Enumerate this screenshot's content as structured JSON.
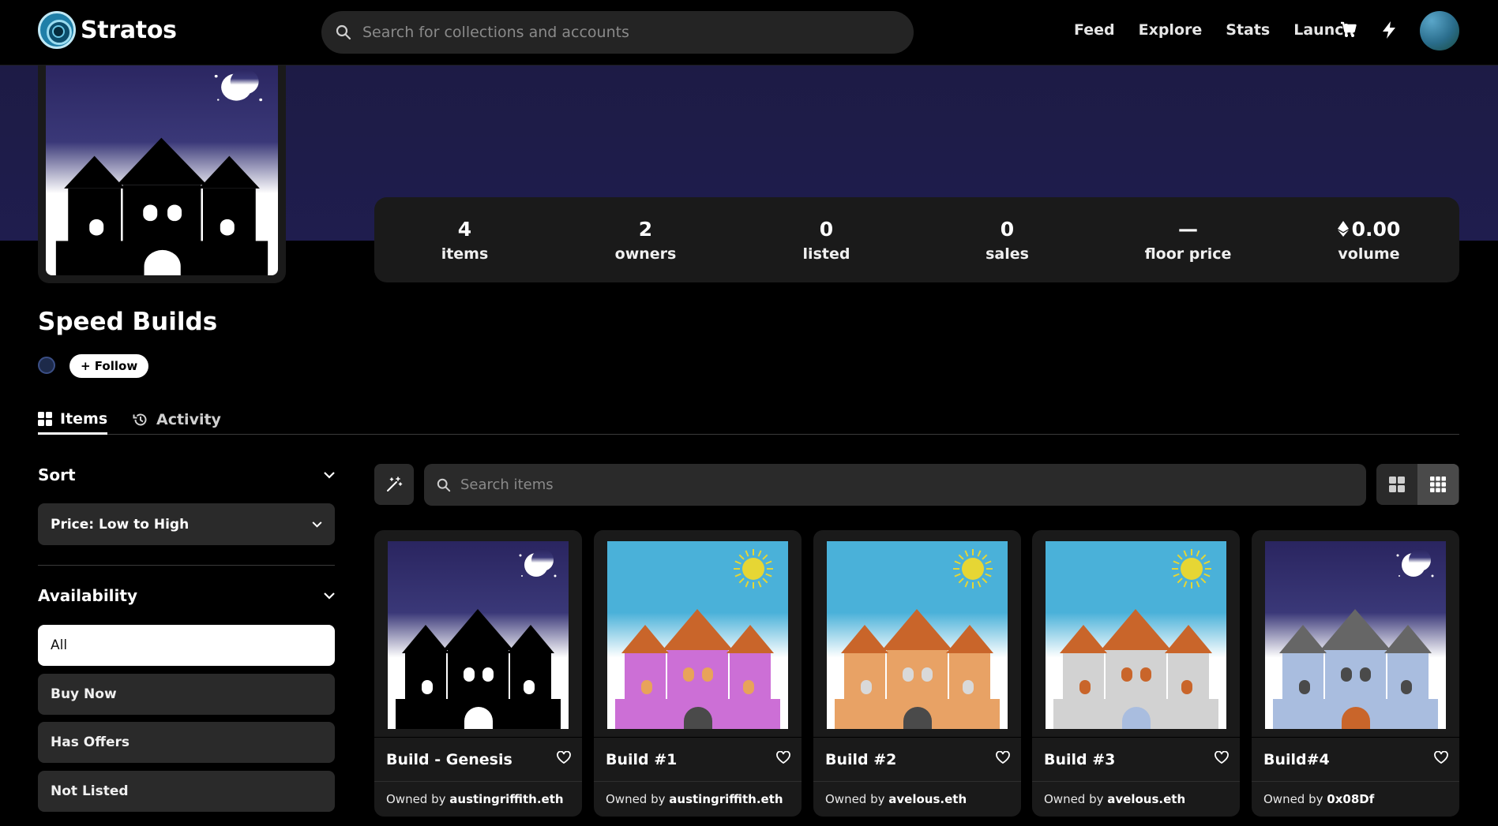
{
  "brand": {
    "name": "Stratos"
  },
  "search": {
    "placeholder": "Search for collections and accounts"
  },
  "nav": {
    "links": [
      "Feed",
      "Explore",
      "Stats",
      "Launch"
    ]
  },
  "collection": {
    "title": "Speed Builds",
    "follow_label": "+ Follow",
    "stats": [
      {
        "value": "4",
        "label": "items"
      },
      {
        "value": "2",
        "label": "owners"
      },
      {
        "value": "0",
        "label": "listed"
      },
      {
        "value": "0",
        "label": "sales"
      },
      {
        "value": "—",
        "label": "floor price"
      },
      {
        "value": "0.00",
        "label": "volume",
        "prefix_icon": "eth-icon"
      }
    ]
  },
  "tabs": [
    {
      "label": "Items",
      "icon": "grid-icon",
      "active": true
    },
    {
      "label": "Activity",
      "icon": "history-icon",
      "active": false
    }
  ],
  "filters": {
    "sort": {
      "heading": "Sort",
      "selected": "Price: Low to High"
    },
    "availability": {
      "heading": "Availability",
      "options": [
        "All",
        "Buy Now",
        "Has Offers",
        "Not Listed"
      ],
      "selected": "All"
    }
  },
  "items_search": {
    "placeholder": "Search items"
  },
  "owned_by_prefix": "Owned by",
  "items": [
    {
      "name": "Build - Genesis",
      "owner": "austingriffith.eth",
      "scene": "night",
      "wall": "#000000",
      "roof": "#000000",
      "window": "#ffffff",
      "door": "#ffffff"
    },
    {
      "name": "Build #1",
      "owner": "austingriffith.eth",
      "scene": "day",
      "wall": "#cc6fd6",
      "roof": "#c9652a",
      "window": "#e8a35a",
      "door": "#4a4a4a"
    },
    {
      "name": "Build #2",
      "owner": "avelous.eth",
      "scene": "day",
      "wall": "#e8a265",
      "roof": "#c9652a",
      "window": "#d9d9d9",
      "door": "#4a4a4a"
    },
    {
      "name": "Build #3",
      "owner": "avelous.eth",
      "scene": "day",
      "wall": "#d2d2d2",
      "roof": "#c9652a",
      "window": "#c9652a",
      "door": "#a9bddf"
    },
    {
      "name": "Build#4",
      "owner": "0x08Df",
      "scene": "night",
      "wall": "#a9bddf",
      "roof": "#666666",
      "window": "#4a4a4a",
      "door": "#c9652a"
    }
  ],
  "colors": {
    "banner": "#1f1d4e",
    "panel": "#1a1a1a",
    "night_sky_top": "#2a2560",
    "day_sky": "#4ab1d9",
    "sun": "#e6d634"
  }
}
